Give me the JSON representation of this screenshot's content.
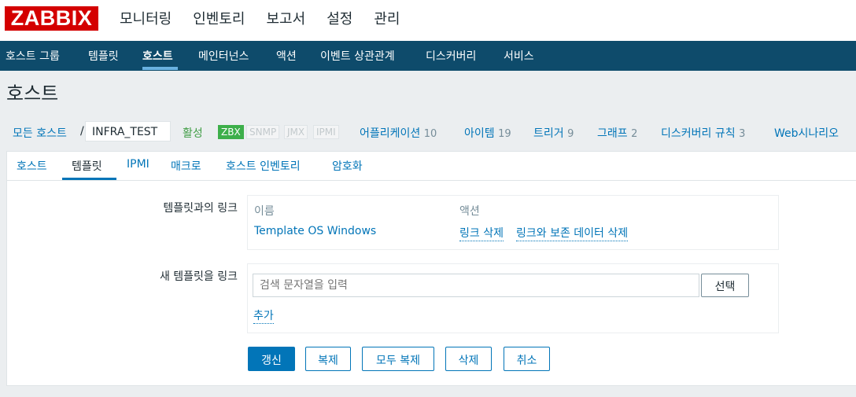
{
  "logo": "ZABBIX",
  "main_menu": [
    "모니터링",
    "인벤토리",
    "보고서",
    "설정",
    "관리"
  ],
  "main_menu_selected": "설정",
  "sub_menu": [
    "호스트 그룹",
    "템플릿",
    "호스트",
    "메인터넌스",
    "액션",
    "이벤트 상관관계",
    "디스커버리",
    "서비스"
  ],
  "sub_menu_active": "호스트",
  "page_title": "호스트",
  "host_nav": {
    "all_hosts": "모든 호스트",
    "separator": "/",
    "host_name": "INFRA_TEST",
    "status": "활성",
    "availability": [
      "ZBX",
      "SNMP",
      "JMX",
      "IPMI"
    ],
    "links": [
      {
        "label": "어플리케이션",
        "count": "10"
      },
      {
        "label": "아이템",
        "count": "19"
      },
      {
        "label": "트리거",
        "count": "9"
      },
      {
        "label": "그래프",
        "count": "2"
      },
      {
        "label": "디스커버리 규칙",
        "count": "3"
      },
      {
        "label": "Web시나리오",
        "count": ""
      }
    ]
  },
  "tabs": [
    "호스트",
    "템플릿",
    "IPMI",
    "매크로",
    "호스트 인벤토리",
    "암호화"
  ],
  "active_tab": "템플릿",
  "linked_templates": {
    "label": "템플릿과의 링크",
    "col_name": "이름",
    "col_action": "액션",
    "rows": [
      {
        "name": "Template OS Windows",
        "unlink": "링크 삭제",
        "unlink_clear": "링크와 보존 데이터 삭제"
      }
    ]
  },
  "new_template": {
    "label": "새 템플릿을 링크",
    "placeholder": "검색 문자열을 입력",
    "select_button": "선택",
    "add_link": "추가"
  },
  "buttons": {
    "update": "갱신",
    "clone": "복제",
    "full_clone": "모두 복제",
    "delete": "삭제",
    "cancel": "취소"
  },
  "colors": {
    "brand_red": "#d40000",
    "nav_blue": "#0e4b6b",
    "link_blue": "#0275b8",
    "zbx_green": "#3daf4a"
  }
}
